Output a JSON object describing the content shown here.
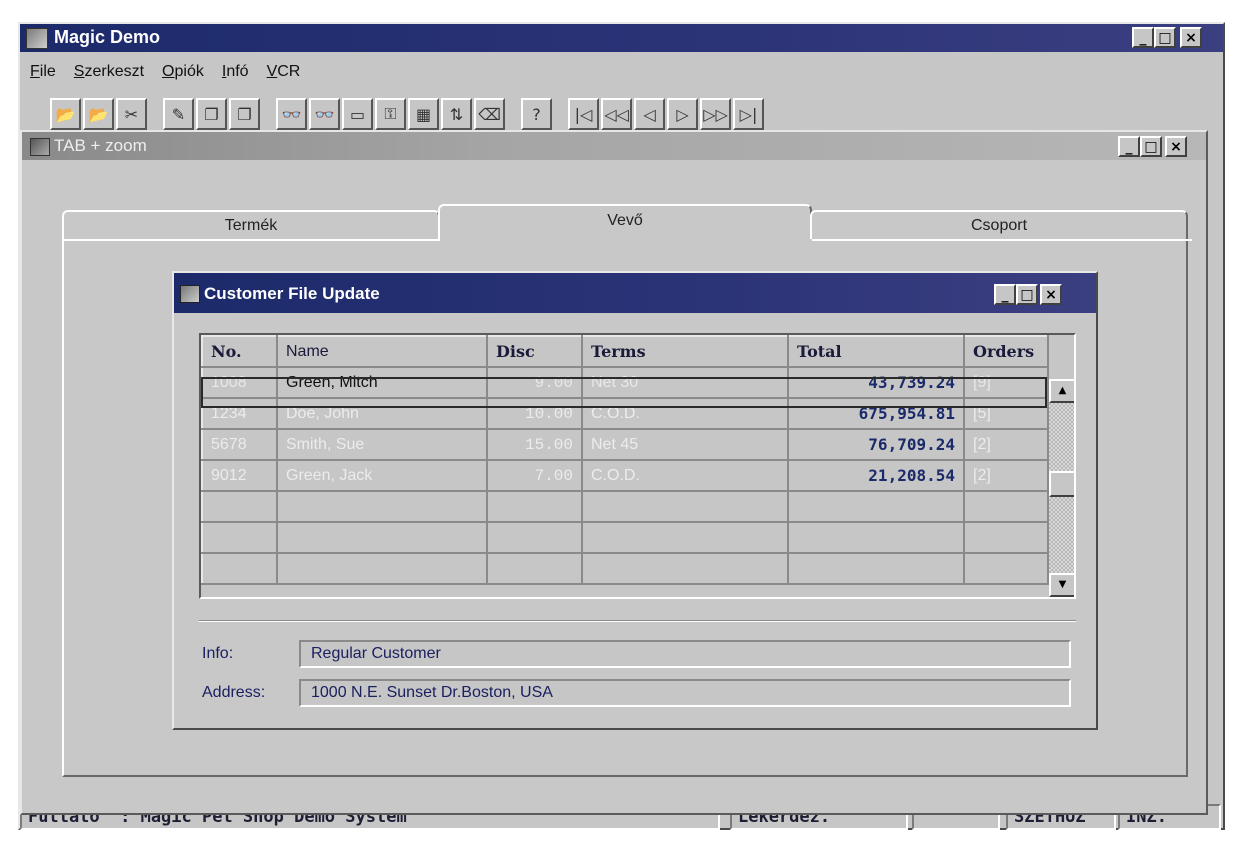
{
  "app": {
    "title": "Magic Demo",
    "menu": [
      {
        "key": "F",
        "rest": "ile"
      },
      {
        "key": "S",
        "rest": "zerkeszt"
      },
      {
        "key": "O",
        "rest": "piók"
      },
      {
        "key": "I",
        "rest": "nfó"
      },
      {
        "key": "V",
        "rest": "CR"
      }
    ],
    "window_controls": {
      "minimize": "_",
      "maximize": "□",
      "close": "×"
    }
  },
  "toolbar": {
    "icons": [
      "open-folder-icon",
      "open-folder-arrow-icon",
      "tools-icon",
      "edit-icon",
      "copy-icon",
      "paste-icon",
      "binoculars-icon",
      "binoculars-plus-icon",
      "window-icon",
      "key-icon",
      "keyboard-icon",
      "arrows-icon",
      "eraser-icon",
      "help-icon",
      "first-record-icon",
      "previous-page-icon",
      "previous-record-icon",
      "next-record-icon",
      "next-page-icon",
      "last-record-icon"
    ],
    "glyphs": [
      "📂",
      "📂",
      "✂",
      "✎",
      "❐",
      "❐",
      "👓",
      "👓",
      "▭",
      "⚿",
      "▦",
      "⇅",
      "⌫",
      "?",
      "|◁",
      "◁◁",
      "◁",
      "▷",
      "▷▷",
      "▷|"
    ]
  },
  "tab_window": {
    "title": "TAB + zoom",
    "tabs": [
      "Termék",
      "Vevő",
      "Csoport"
    ],
    "active_tab": "Vevő"
  },
  "customer_window": {
    "title": "Customer File Update",
    "columns": [
      "No.",
      "Name",
      "Disc",
      "Terms",
      "Total",
      "Orders"
    ],
    "rows": [
      {
        "no": "1008",
        "name": "Green, Mitch",
        "disc": "9.00",
        "terms": "Net 30",
        "total": "43,739.24",
        "orders": "[9]"
      },
      {
        "no": "1234",
        "name": "Doe, John",
        "disc": "10.00",
        "terms": "C.O.D.",
        "total": "675,954.81",
        "orders": "[5]"
      },
      {
        "no": "5678",
        "name": "Smith, Sue",
        "disc": "15.00",
        "terms": "Net 45",
        "total": "76,709.24",
        "orders": "[2]"
      },
      {
        "no": "9012",
        "name": "Green, Jack",
        "disc": "7.00",
        "terms": "C.O.D.",
        "total": "21,208.54",
        "orders": "[2]"
      }
    ],
    "info_label": "Info:",
    "info_value": "Regular Customer",
    "address_label": "Address:",
    "address_value": "1000 N.E. Sunset Dr.Boston, USA"
  },
  "status_bar": {
    "left": "Futtató  : Magic Pet Shop Demo System",
    "mode": "Lekérdez.",
    "empty": "",
    "zoom": "SZÉTHÚZ",
    "insert": "INZ."
  },
  "colors": {
    "titlebar": "#1c2a6a",
    "face": "#c6c6c6",
    "text_blue": "#1a2060"
  }
}
